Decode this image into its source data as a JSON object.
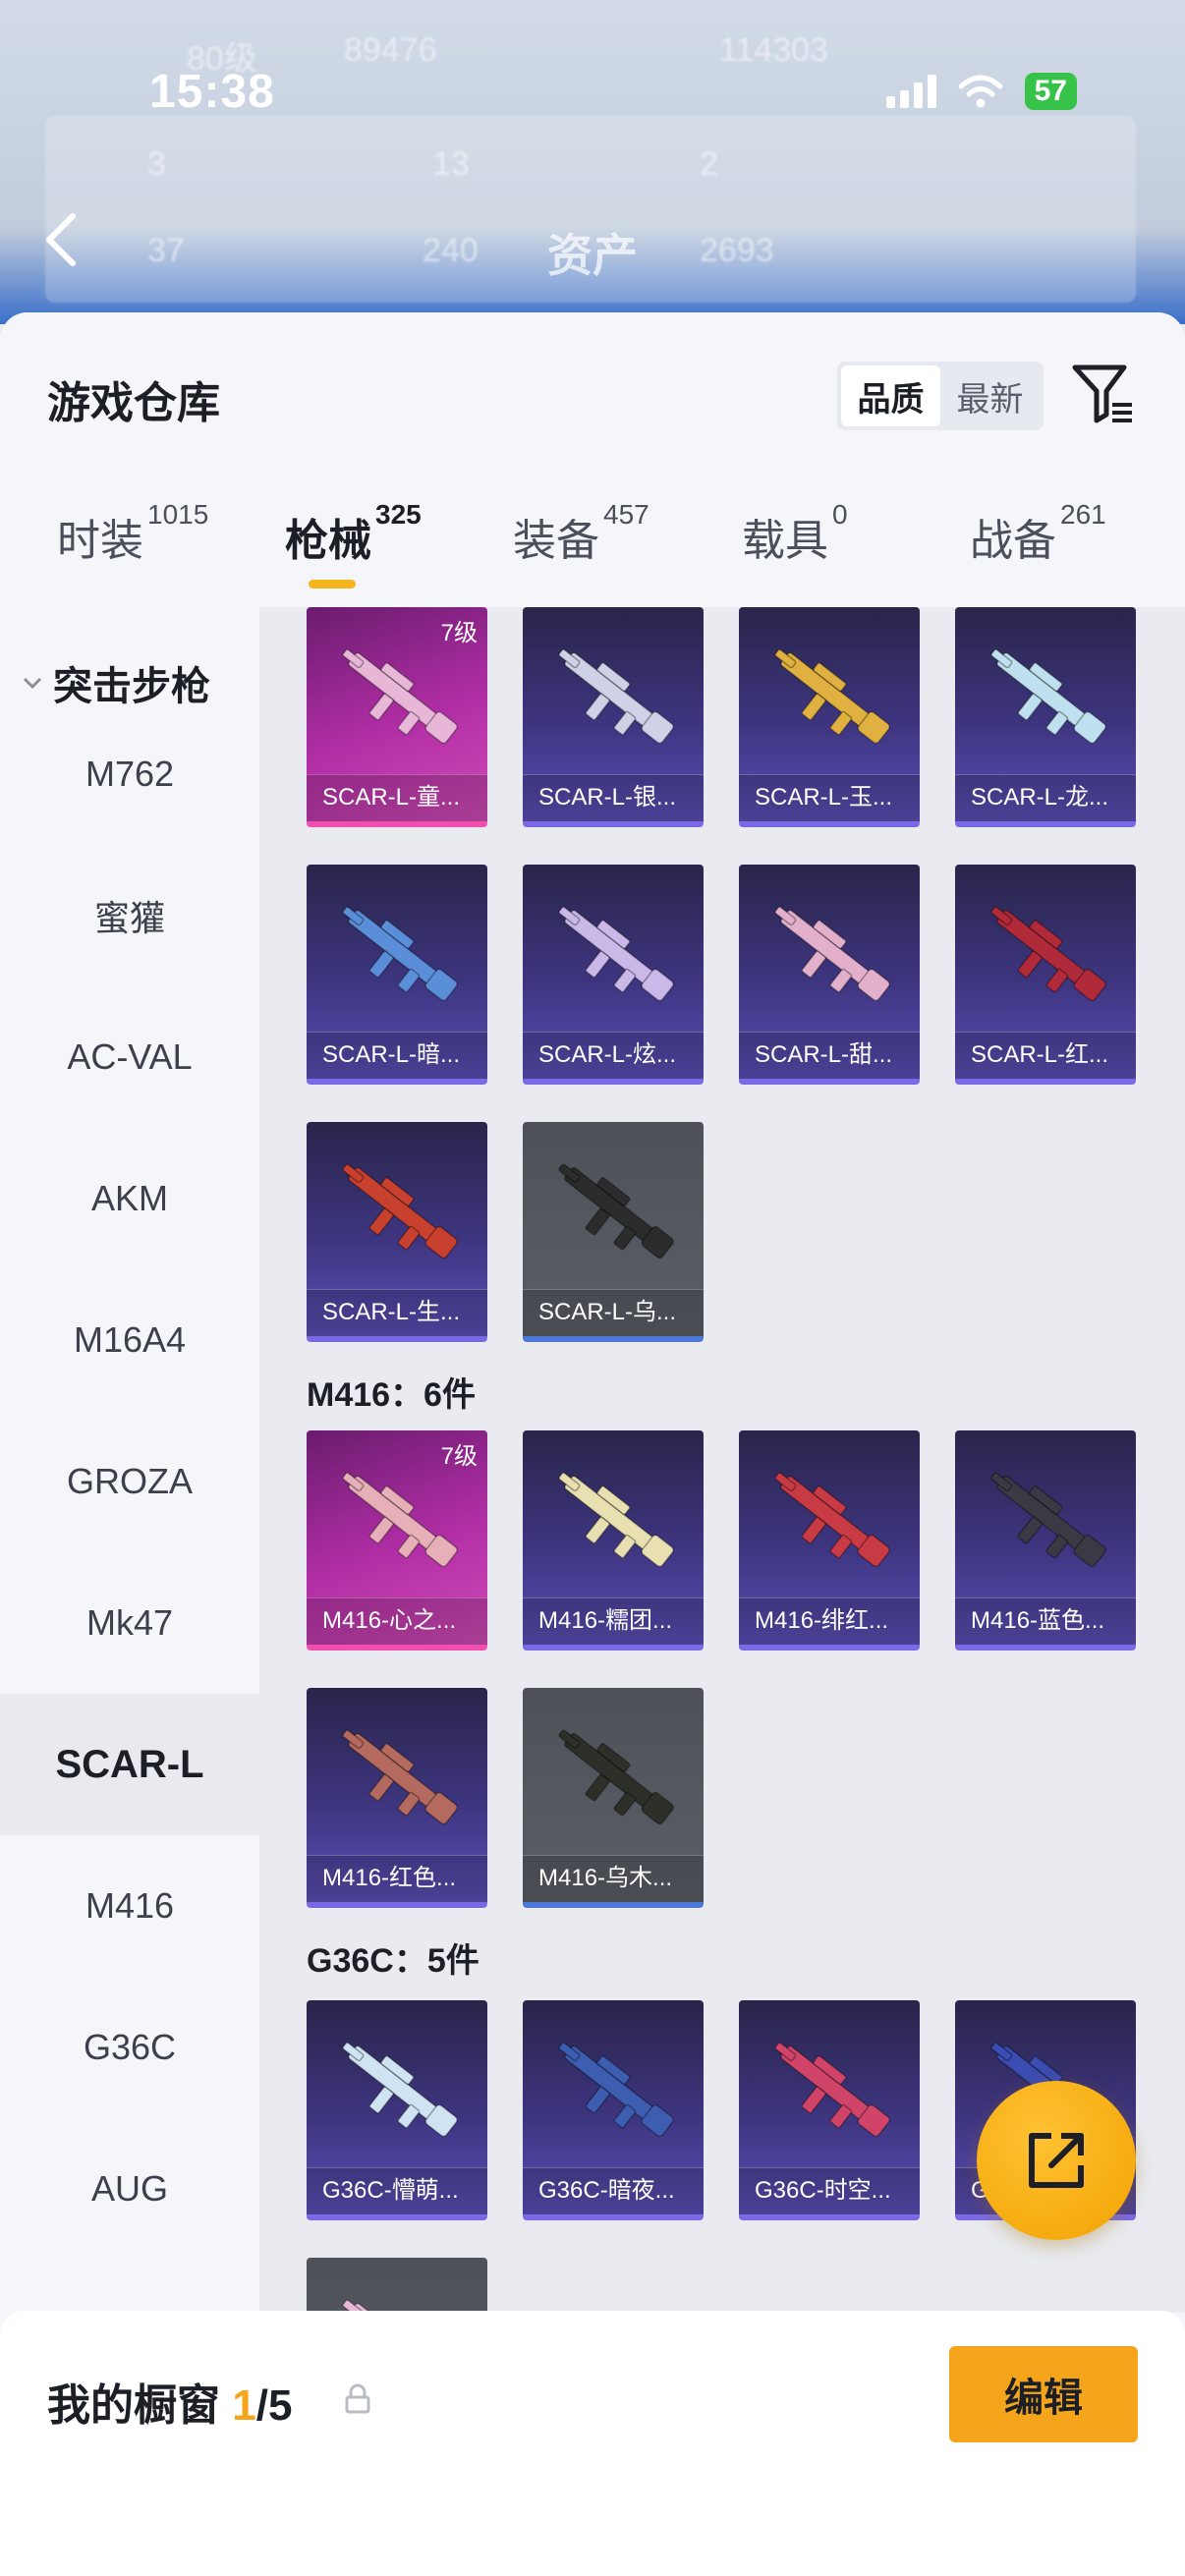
{
  "status_bar": {
    "time": "15:38",
    "battery": "57"
  },
  "nav": {
    "title": "资产"
  },
  "background_ghost": [
    {
      "text": "80级"
    },
    {
      "text": "89476"
    },
    {
      "text": "114303"
    },
    {
      "text": "3"
    },
    {
      "text": "13"
    },
    {
      "text": "2"
    },
    {
      "text": "37"
    },
    {
      "text": "240"
    },
    {
      "text": "2693"
    }
  ],
  "sheet": {
    "title": "游戏仓库",
    "sort": {
      "quality": "品质",
      "latest": "最新"
    }
  },
  "tabs": [
    {
      "label": "时装",
      "count": "1015"
    },
    {
      "label": "枪械",
      "count": "325"
    },
    {
      "label": "装备",
      "count": "457"
    },
    {
      "label": "载具",
      "count": "0"
    },
    {
      "label": "战备",
      "count": "261"
    }
  ],
  "sidebar": {
    "group": "突击步枪",
    "items": [
      "M762",
      "蜜獾",
      "AC-VAL",
      "AKM",
      "M16A4",
      "GROZA",
      "Mk47",
      "SCAR-L",
      "M416",
      "G36C",
      "AUG"
    ]
  },
  "sections": {
    "m416": "M416：6件",
    "g36c": "G36C：5件"
  },
  "cards": {
    "scar": [
      {
        "name": "SCAR-L-童...",
        "level": "7级"
      },
      {
        "name": "SCAR-L-银..."
      },
      {
        "name": "SCAR-L-玉..."
      },
      {
        "name": "SCAR-L-龙..."
      },
      {
        "name": "SCAR-L-暗..."
      },
      {
        "name": "SCAR-L-炫..."
      },
      {
        "name": "SCAR-L-甜..."
      },
      {
        "name": "SCAR-L-红..."
      },
      {
        "name": "SCAR-L-生..."
      },
      {
        "name": "SCAR-L-乌..."
      }
    ],
    "m416": [
      {
        "name": "M416-心之...",
        "level": "7级"
      },
      {
        "name": "M416-糯团..."
      },
      {
        "name": "M416-绯红..."
      },
      {
        "name": "M416-蓝色..."
      },
      {
        "name": "M416-红色..."
      },
      {
        "name": "M416-乌木..."
      }
    ],
    "g36c": [
      {
        "name": "G36C-懵萌..."
      },
      {
        "name": "G36C-暗夜..."
      },
      {
        "name": "G36C-时空..."
      },
      {
        "name": "G"
      }
    ]
  },
  "showcase": {
    "label": "我的橱窗",
    "current": "1",
    "total": "/5",
    "edit": "编辑"
  },
  "colors": {
    "accent": "#f5a51c",
    "legendary": "#f04fb0",
    "epic": "#7b6ae6",
    "rare": "#4e79d9"
  }
}
